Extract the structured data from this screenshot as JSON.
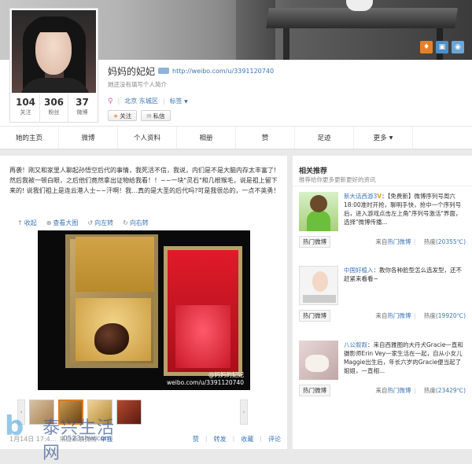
{
  "profile": {
    "name": "妈妈的妃妃",
    "url": "http://weibo.com/u/3391120740",
    "desc": "她还没有填写个人简介",
    "gender_symbol": "♀",
    "location": "北京 东城区",
    "tag_label": "标签",
    "follow_label": "关注",
    "message_label": "私信",
    "stats": [
      {
        "num": "104",
        "label": "关注"
      },
      {
        "num": "306",
        "label": "粉丝"
      },
      {
        "num": "37",
        "label": "微博"
      }
    ]
  },
  "nav": {
    "tabs": [
      "她的主页",
      "微博",
      "个人资料",
      "相册",
      "赞",
      "足迹",
      "更多"
    ]
  },
  "post": {
    "text": "再袭！刚又和家里人聊起孙悟空后代的事情，我死活不信，我说，内们是不是大脑内存太丰富了!然后我被一顿白眼，之后他们竟然拿出证物给我看！！~~一块\"灵石\"和几根猴毛，说是祖上留下来的! 说我们祖上是连云港人士~~汗啊！我…真的是大圣的后代吗?可是我很怂的，一点不英勇！",
    "toolbar": [
      "收起",
      "查看大图",
      "向左转",
      "向右转"
    ],
    "watermark_name": "@妈妈的妃妃",
    "watermark_url": "weibo.com/u/3391120740",
    "time": "1月14日 17:4...",
    "source": "来自新浪微博",
    "report": "举报",
    "actions": [
      "赞",
      "转发",
      "收藏",
      "评论"
    ]
  },
  "site_logo": {
    "letter": "b",
    "name": "泰兴生活网",
    "domain": "0523shw.com"
  },
  "sidebar": {
    "title": "相关推荐",
    "subtitle": "推荐给你更多更新更好的资讯",
    "items": [
      {
        "author": "新大话西游3",
        "vmark": "V",
        "text": "：【免费新】微博序列号周六18:00准时开抢，聊明手快，抢中一个序列号后，进入游戏点击左上角\"序列号激活\"界面，选择\"微博传播...",
        "tag": "热门微博",
        "from_prefix": "来自",
        "from_link": "热门微博",
        "heat_label": "热度",
        "heat_value": "(20355℃)"
      },
      {
        "author": "中国好植入",
        "vmark": "",
        "text": "：教你各种脸型怎么选发型，还不赶紧来看看~",
        "tag": "热门微博",
        "from_prefix": "来自",
        "from_link": "热门微博",
        "heat_label": "热度",
        "heat_value": "(19920℃)"
      },
      {
        "author": "八公叙叙",
        "vmark": "",
        "text": "：来自西雅图的大丹犬Gracie一直和摄影师Erin Vey一家生活在一起，自从小女儿Maggie出生后，年长六岁的Gracie便当起了姐姐，一直相...",
        "tag": "热门微博",
        "from_prefix": "来自",
        "from_link": "热门微博",
        "heat_label": "热度",
        "heat_value": "(23429℃)"
      }
    ]
  }
}
